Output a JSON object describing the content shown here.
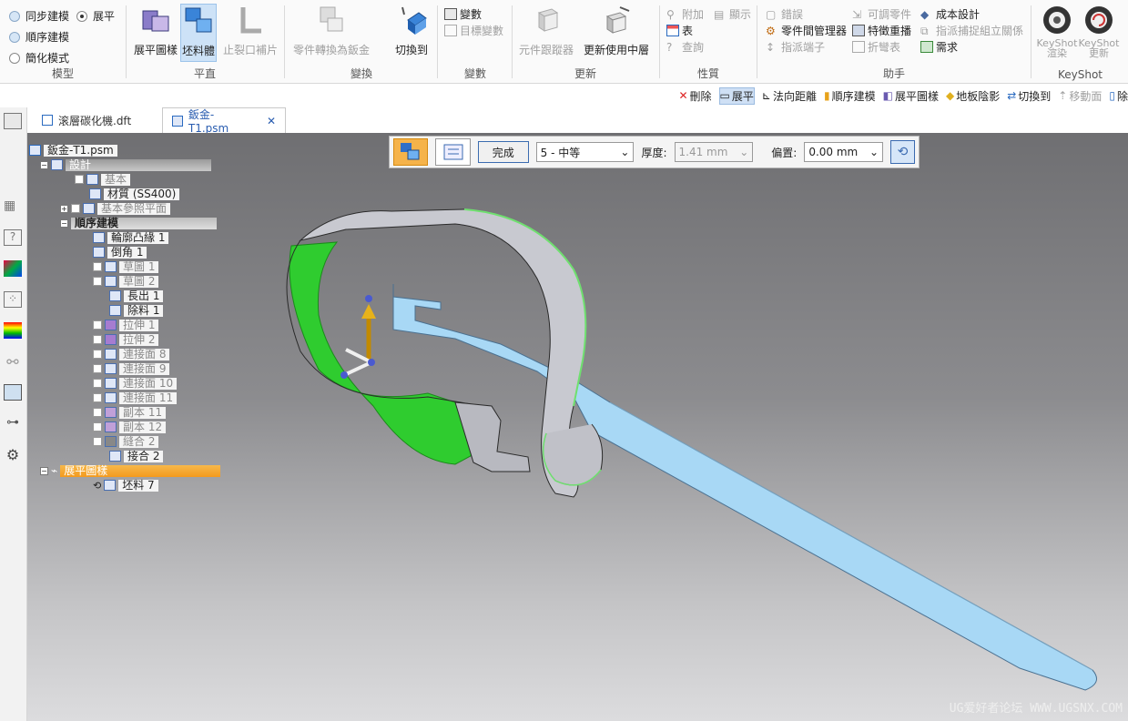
{
  "ribbon": {
    "model": {
      "sync": "同步建模",
      "flat": "展平",
      "ordered": "順序建模",
      "simplified": "簡化模式",
      "group_label": "模型"
    },
    "plane": {
      "flat_pattern": "展平圖樣",
      "blank": "坯料體",
      "stop_tear": "止裂口補片",
      "group_label": "平直"
    },
    "transform": {
      "convert": "零件轉換為鈑金",
      "switch": "切換到",
      "group_label": "變換"
    },
    "variables": {
      "vars": "變數",
      "goal_seek": "目標變數",
      "group_label": "變數"
    },
    "update": {
      "tracker": "元件跟蹤器",
      "update_active": "更新使用中層",
      "group_label": "更新"
    },
    "props": {
      "attach": "附加",
      "show": "顯示",
      "table": "表",
      "query": "查詢",
      "group_label": "性質"
    },
    "helpers": {
      "errors": "錯誤",
      "interpart": "零件間管理器",
      "assign_end": "指派端子",
      "adjustable": "可調零件",
      "feature_playback": "特徵重播",
      "bend_table": "折彎表",
      "cost": "成本設計",
      "capture_fit": "指派捕捉組立關係",
      "requirements": "需求",
      "group_label": "助手"
    },
    "keyshot": {
      "render": "KeyShot 渲染",
      "update": "KeyShot 更新",
      "group_label": "KeyShot"
    }
  },
  "cmdbar": {
    "delete": "刪除",
    "flatten": "展平",
    "normal_distance": "法向距離",
    "ordered": "順序建模",
    "flat_pattern": "展平圖樣",
    "floor_shadow": "地板陰影",
    "switch": "切換到",
    "move_face": "移動面",
    "remove": "除"
  },
  "tabs": [
    {
      "label": "滚層碳化機.dft"
    },
    {
      "label": "鈑金-T1.psm"
    }
  ],
  "tree": {
    "root": "鈑金-T1.psm",
    "design": "設計",
    "base": "基本",
    "material": "材質 (SS400)",
    "base_planes": "基本參照平面",
    "ordered": "順序建模",
    "items": [
      "輪廓凸緣 1",
      "倒角 1",
      "草圖 1",
      "草圖 2",
      "長出 1",
      "除料 1",
      "拉伸 1",
      "拉伸 2",
      "連接面 8",
      "連接面 9",
      "連接面 10",
      "連接面 11",
      "副本 11",
      "副本 12",
      "縫合 2",
      "接合 2"
    ],
    "flat_pattern": "展平圖樣",
    "blank": "坯料 7"
  },
  "featurebar": {
    "done": "完成",
    "quality": "5 - 中等",
    "thickness_label": "厚度:",
    "thickness": "1.41 mm",
    "offset_label": "偏置:",
    "offset": "0.00 mm"
  },
  "watermark": "UG爱好者论坛 WWW.UGSNX.COM"
}
